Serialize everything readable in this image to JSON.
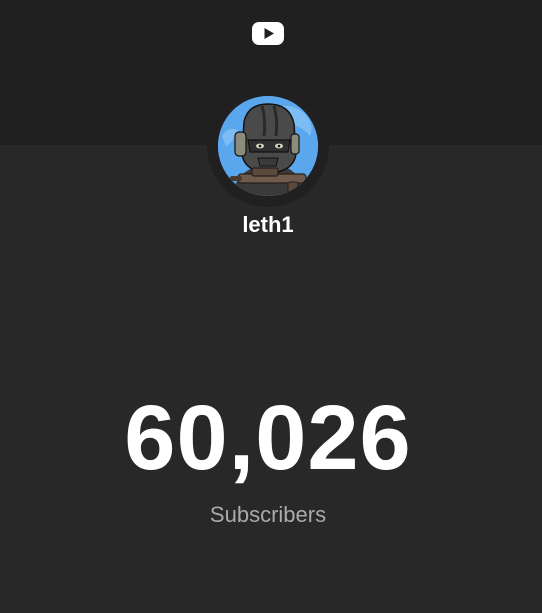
{
  "header": {
    "logo_icon": "youtube-play-icon"
  },
  "channel": {
    "name": "leth1",
    "avatar_icon": "masked-soldier-avatar"
  },
  "stats": {
    "subscriber_count": "60,026",
    "subscriber_label": "Subscribers"
  },
  "colors": {
    "background": "#282828",
    "header_band": "#202020",
    "text_primary": "#ffffff",
    "text_secondary": "#aaaaaa",
    "avatar_sky": "#5aa7ee"
  }
}
